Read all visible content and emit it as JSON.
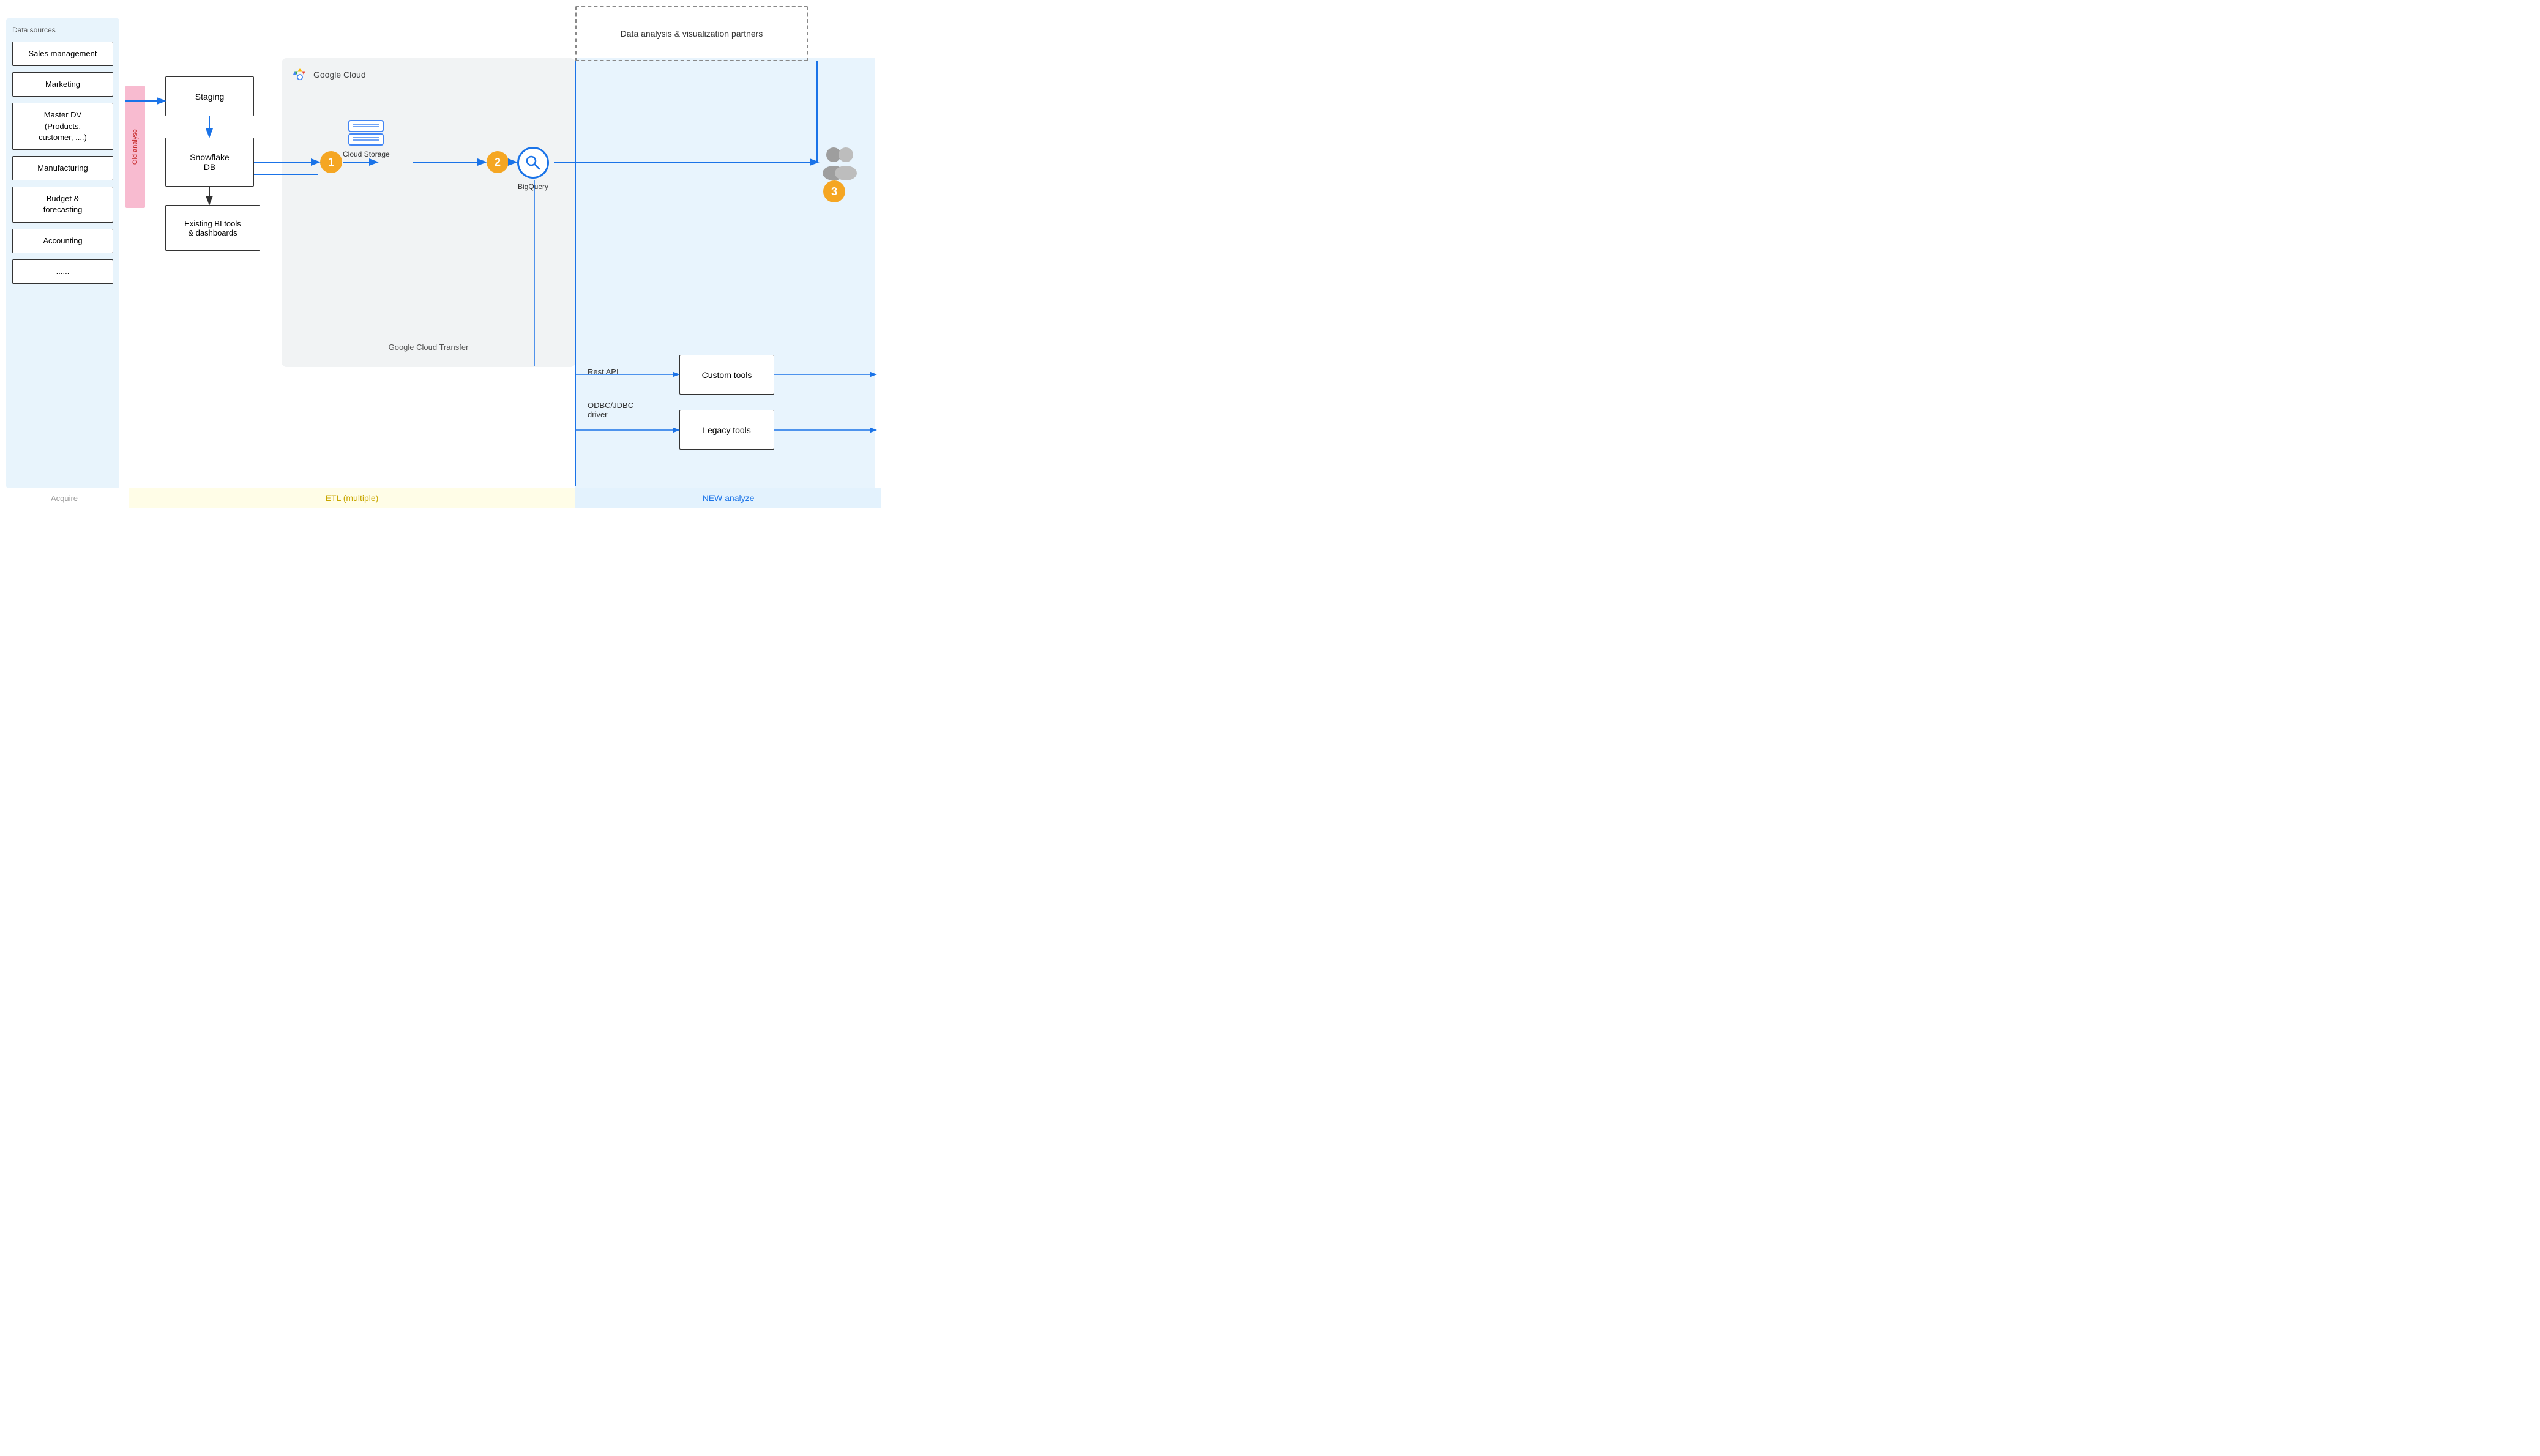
{
  "phases": {
    "acquire": "Acquire",
    "etl": "ETL (multiple)",
    "new_analyze": "NEW analyze"
  },
  "data_sources": {
    "label": "Data sources",
    "items": [
      {
        "id": "sales",
        "text": "Sales management"
      },
      {
        "id": "marketing",
        "text": "Marketing"
      },
      {
        "id": "master_dv",
        "text": "Master DV\n(Products,\ncustomer, ....)"
      },
      {
        "id": "manufacturing",
        "text": "Manufacturing"
      },
      {
        "id": "budget",
        "text": "Budget &\nforecasting"
      },
      {
        "id": "accounting",
        "text": "Accounting"
      },
      {
        "id": "dots",
        "text": "......"
      }
    ]
  },
  "old_analyse_label": "Old analyse",
  "flow_boxes": {
    "staging": "Staging",
    "snowflake": "Snowflake\nDB",
    "bi_tools": "Existing BI tools\n& dashboards"
  },
  "gcloud": {
    "name": "Google Cloud",
    "cloud_storage_label": "Cloud Storage",
    "bigquery_label": "BigQuery",
    "transfer_label": "Google Cloud Transfer"
  },
  "numbers": [
    "1",
    "2",
    "3"
  ],
  "dashed_box_label": "Data analysis & visualization partners",
  "api_labels": {
    "rest": "Rest API",
    "odbc": "ODBC/JDBC\ndriver"
  },
  "tool_boxes": {
    "custom": "Custom tools",
    "legacy": "Legacy tools"
  },
  "colors": {
    "blue_arrow": "#1a73e8",
    "orange": "#f5a623",
    "pink": "#f8bbd0"
  }
}
